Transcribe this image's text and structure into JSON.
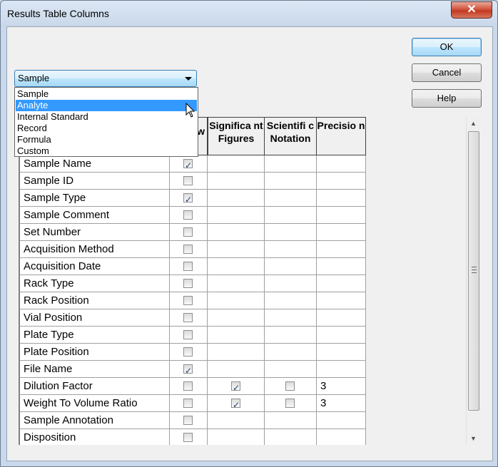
{
  "window": {
    "title": "Results Table Columns",
    "close_glyph": "✕"
  },
  "buttons": {
    "ok": "OK",
    "cancel": "Cancel",
    "help": "Help"
  },
  "combo": {
    "selected": "Sample",
    "options": [
      "Sample",
      "Analyte",
      "Internal Standard",
      "Record",
      "Formula",
      "Custom"
    ],
    "highlighted": "Analyte"
  },
  "columns": {
    "show": "w",
    "sig_figs": "Significa nt Figures",
    "sci_notation": "Scientifi c Notation",
    "precision": "Precisio n"
  },
  "rows": [
    {
      "name": "Sample Name",
      "show": true,
      "sig": null,
      "sci": null,
      "prec": ""
    },
    {
      "name": "Sample ID",
      "show": false,
      "sig": null,
      "sci": null,
      "prec": ""
    },
    {
      "name": "Sample Type",
      "show": true,
      "sig": null,
      "sci": null,
      "prec": ""
    },
    {
      "name": "Sample Comment",
      "show": false,
      "sig": null,
      "sci": null,
      "prec": ""
    },
    {
      "name": "Set Number",
      "show": false,
      "sig": null,
      "sci": null,
      "prec": ""
    },
    {
      "name": "Acquisition Method",
      "show": false,
      "sig": null,
      "sci": null,
      "prec": ""
    },
    {
      "name": "Acquisition Date",
      "show": false,
      "sig": null,
      "sci": null,
      "prec": ""
    },
    {
      "name": "Rack Type",
      "show": false,
      "sig": null,
      "sci": null,
      "prec": ""
    },
    {
      "name": "Rack Position",
      "show": false,
      "sig": null,
      "sci": null,
      "prec": ""
    },
    {
      "name": "Vial Position",
      "show": false,
      "sig": null,
      "sci": null,
      "prec": ""
    },
    {
      "name": "Plate Type",
      "show": false,
      "sig": null,
      "sci": null,
      "prec": ""
    },
    {
      "name": "Plate Position",
      "show": false,
      "sig": null,
      "sci": null,
      "prec": ""
    },
    {
      "name": "File Name",
      "show": true,
      "sig": null,
      "sci": null,
      "prec": ""
    },
    {
      "name": "Dilution Factor",
      "show": false,
      "sig": true,
      "sci": false,
      "prec": "3"
    },
    {
      "name": "Weight To Volume Ratio",
      "show": false,
      "sig": true,
      "sci": false,
      "prec": "3"
    },
    {
      "name": "Sample Annotation",
      "show": false,
      "sig": null,
      "sci": null,
      "prec": ""
    },
    {
      "name": "Disposition",
      "show": false,
      "sig": null,
      "sci": null,
      "prec": ""
    }
  ],
  "scrollbar": {
    "up_glyph": "▲",
    "down_glyph": "▼"
  },
  "colors": {
    "selection": "#3399ff",
    "checkmark": "#1f3d73"
  }
}
